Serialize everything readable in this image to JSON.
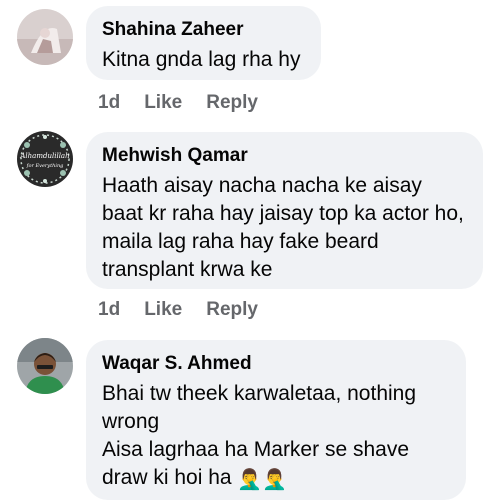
{
  "comments": [
    {
      "author": "Shahina Zaheer",
      "text": "Kitna gnda lag rha hy",
      "time": "1d",
      "like_label": "Like",
      "reply_label": "Reply"
    },
    {
      "author": "Mehwish Qamar",
      "avatar_text": "Alhamdulillah for Everything",
      "text": "Haath aisay nacha nacha ke aisay baat kr raha hay jaisay top ka actor ho, maila lag raha hay fake beard transplant krwa ke",
      "time": "1d",
      "like_label": "Like",
      "reply_label": "Reply"
    },
    {
      "author": "Waqar S. Ahmed",
      "text_line1": "Bhai tw theek karwaletaa, nothing wrong",
      "text_line2": "Aisa lagrhaa ha Marker se shave draw ki hoi ha",
      "emoji": "🤦‍♂️🤦‍♂️"
    }
  ],
  "colors": {
    "bubble": "#f0f2f5",
    "text": "#050505",
    "meta": "#65676b"
  }
}
